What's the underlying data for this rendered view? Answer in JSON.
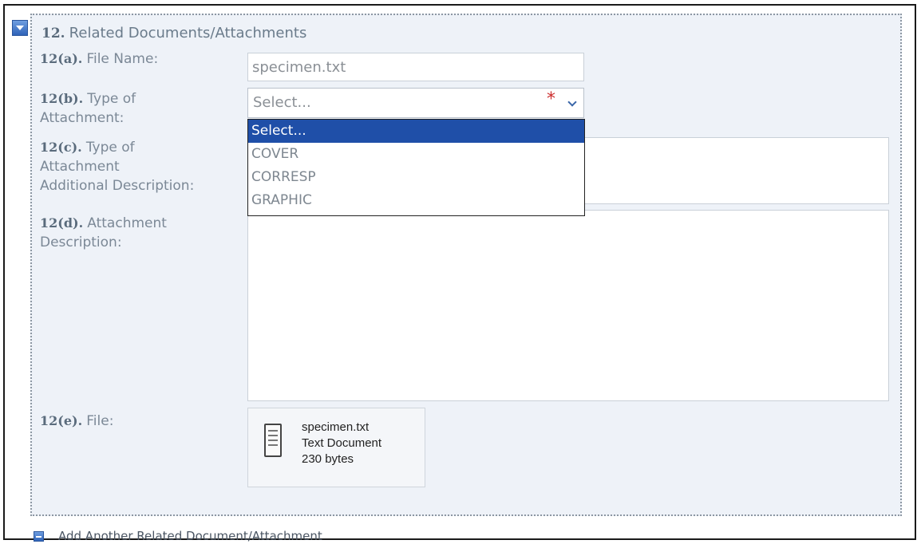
{
  "section": {
    "number": "12.",
    "title": "Related Documents/Attachments"
  },
  "fields": {
    "file_name": {
      "number": "12(a).",
      "label": "File Name:",
      "value": "specimen.txt"
    },
    "type": {
      "number": "12(b).",
      "label_line1": "Type of",
      "label_line2": "Attachment:",
      "value": "Select...",
      "required_mark": "*"
    },
    "additional": {
      "number": "12(c).",
      "label_line1": "Type of",
      "label_line2": "Attachment",
      "label_line3": "Additional Description:"
    },
    "description": {
      "number": "12(d).",
      "label_line1": "Attachment",
      "label_line2": "Description:"
    },
    "file": {
      "number": "12(e).",
      "label": "File:",
      "name": "specimen.txt",
      "kind": "Text Document",
      "size": "230 bytes"
    }
  },
  "dropdown": {
    "options": [
      "Select...",
      "COVER",
      "CORRESP",
      "GRAPHIC"
    ],
    "selected_index": 0
  },
  "footer": {
    "add_label": "Add Another Related Document/Attachment"
  },
  "icons": {
    "collapse": "collapse-arrow-icon",
    "dropdown": "chevron-down-icon",
    "file": "text-document-icon",
    "add": "add-icon"
  },
  "colors": {
    "accent": "#1f4fa8",
    "required": "#cc2d2d",
    "section_bg": "#eef2f8"
  }
}
